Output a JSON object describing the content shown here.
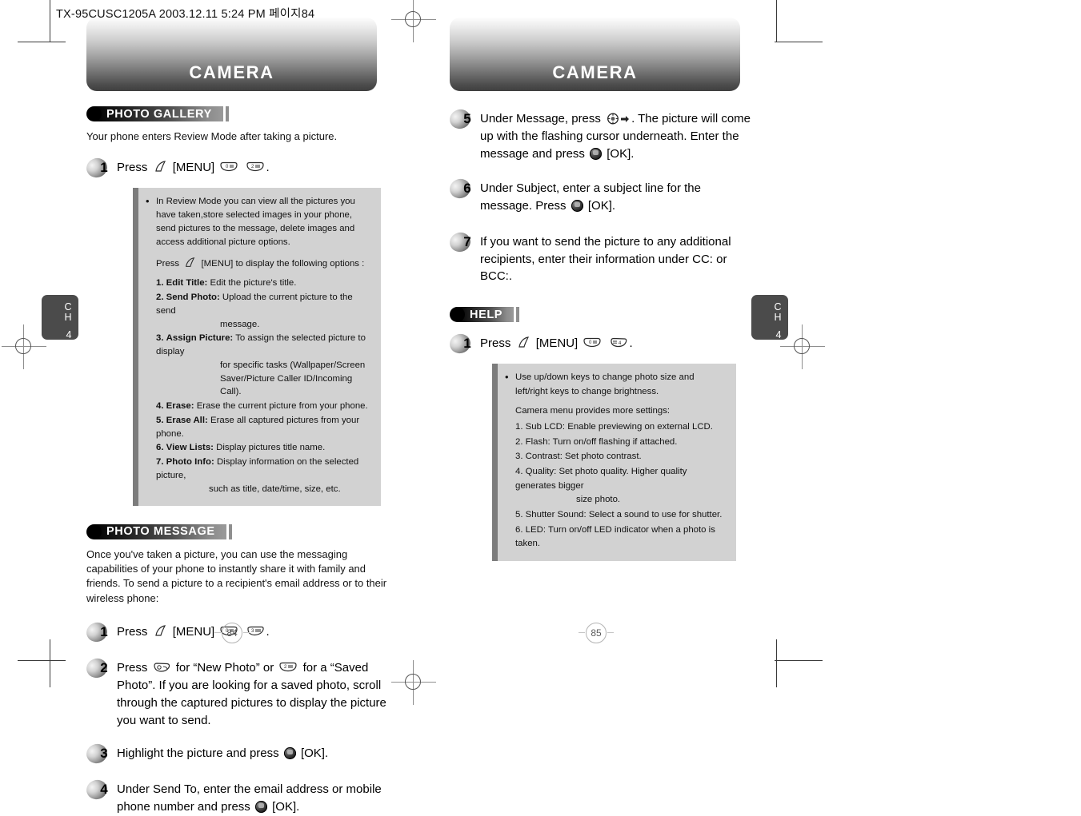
{
  "slug": "TX-95CUSC1205A  2003.12.11 5:24 PM  페이지84",
  "left_page": {
    "banner_title": "CAMERA",
    "chapter_tab": {
      "line1": "C",
      "line2": "H",
      "number": "4"
    },
    "page_number": "84",
    "sections": [
      {
        "badge": "PHOTO GALLERY",
        "intro": "Your phone enters Review Mode after taking a picture.",
        "steps": [
          {
            "num": "1",
            "text_before": "Press",
            "label": "[MENU]",
            "text_after": "."
          }
        ],
        "note": {
          "bullet_paragraph": "In Review Mode you can view all the pictures you have taken,store selected images in your phone, send pictures to the message, delete images and access additional picture options.",
          "press_line_before": "Press",
          "press_line_after": "[MENU] to display the following options :",
          "options": [
            {
              "n": "1.",
              "term": "Edit Title:",
              "desc": "Edit the picture's title.",
              "cont": []
            },
            {
              "n": "2.",
              "term": "Send Photo:",
              "desc": "Upload the current picture to the send",
              "cont": [
                "message."
              ]
            },
            {
              "n": "3.",
              "term": "Assign Picture:",
              "desc": "To assign the selected picture to display",
              "cont": [
                "for specific tasks (Wallpaper/Screen",
                "Saver/Picture Caller ID/Incoming Call)."
              ]
            },
            {
              "n": "4.",
              "term": "Erase:",
              "desc": "Erase the current picture from your phone.",
              "cont": []
            },
            {
              "n": "5.",
              "term": "Erase All:",
              "desc": "Erase all captured pictures from your phone.",
              "cont": []
            },
            {
              "n": "6.",
              "term": "View Lists:",
              "desc": "Display pictures title name.",
              "cont": []
            },
            {
              "n": "7.",
              "term": "Photo Info:",
              "desc": "Display information on the selected picture,",
              "cont": [
                "such as title, date/time, size, etc."
              ]
            }
          ]
        }
      },
      {
        "badge": "PHOTO MESSAGE",
        "intro": "Once you've taken a picture, you can use the messaging capabilities of your phone to instantly share it with family and friends. To send a picture to a recipient's email address or to their wireless phone:",
        "steps": [
          {
            "num": "1",
            "text_before": "Press",
            "label": "[MENU]",
            "text_after": "."
          },
          {
            "num": "2",
            "part1": "Press",
            "part2": "for “New Photo” or",
            "part3": "for a “Saved Photo”.  If you are looking for a saved photo, scroll through the captured pictures to display the picture you want to send."
          },
          {
            "num": "3",
            "part1": "Highlight the picture and press",
            "part2": "[OK]."
          },
          {
            "num": "4",
            "part1": "Under Send To, enter the email address or mobile phone number and press",
            "part2": "[OK]."
          }
        ]
      }
    ]
  },
  "right_page": {
    "banner_title": "CAMERA",
    "chapter_tab": {
      "line1": "C",
      "line2": "H",
      "number": "4"
    },
    "page_number": "85",
    "steps": [
      {
        "num": "5",
        "part1": "Under Message, press",
        "part2": ". The picture will come up with the flashing cursor underneath.  Enter the message and press",
        "part3": "[OK]."
      },
      {
        "num": "6",
        "part1": "Under Subject, enter a subject line for the message. Press",
        "part2": "[OK]."
      },
      {
        "num": "7",
        "part1": "If you want to send the picture to any additional recipients, enter their information under CC: or BCC:."
      }
    ],
    "help_section": {
      "badge": "HELP",
      "step": {
        "num": "1",
        "text_before": "Press",
        "label": "[MENU]",
        "text_after": "."
      },
      "note": {
        "bullet_paragraph": "Use up/down keys to change photo size and left/right keys to change brightness.",
        "subtitle": "Camera menu provides more settings:",
        "options": [
          {
            "n": "1.",
            "text": "Sub LCD: Enable previewing on external LCD.",
            "cont": []
          },
          {
            "n": "2.",
            "text": "Flash: Turn on/off flashing if attached.",
            "cont": []
          },
          {
            "n": "3.",
            "text": "Contrast: Set photo contrast.",
            "cont": []
          },
          {
            "n": "4.",
            "text": "Quality: Set photo quality. Higher quality generates bigger",
            "cont": [
              "size photo."
            ]
          },
          {
            "n": "5.",
            "text": "Shutter Sound: Select a sound to use for shutter.",
            "cont": []
          },
          {
            "n": "6.",
            "text": "LED: Turn on/off LED indicator when a photo is taken.",
            "cont": []
          }
        ]
      }
    }
  },
  "key_icons": {
    "softkey": "softkey-icon",
    "key_0": "0",
    "key_2": "2",
    "key_3": "3",
    "key_4": "4",
    "ok": "ok-button-icon",
    "nav": "navigation-key-icon",
    "arrow": "right-arrow-icon",
    "camera_key": "camera-key-icon"
  },
  "colors": {
    "banner_dark": "#3f3f3f",
    "note_panel": "#d2d2d2",
    "note_rail": "#7c7c7c",
    "tab": "#4b4b4b"
  }
}
